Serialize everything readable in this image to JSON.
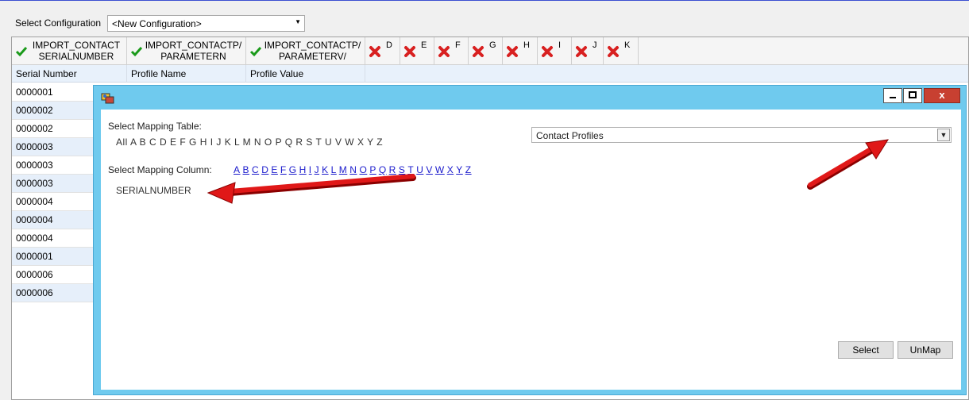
{
  "config": {
    "label": "Select Configuration",
    "value": "<New Configuration>"
  },
  "grid": {
    "headers": [
      {
        "status": "ok",
        "line1": "IMPORT_CONTACT",
        "line2": "SERIALNUMBER"
      },
      {
        "status": "ok",
        "line1": "IMPORT_CONTACTP/",
        "line2": "PARAMETERN"
      },
      {
        "status": "ok",
        "line1": "IMPORT_CONTACTP/",
        "line2": "PARAMETERV/"
      },
      {
        "status": "error",
        "letter": "D"
      },
      {
        "status": "error",
        "letter": "E"
      },
      {
        "status": "error",
        "letter": "F"
      },
      {
        "status": "error",
        "letter": "G"
      },
      {
        "status": "error",
        "letter": "H"
      },
      {
        "status": "error",
        "letter": "I"
      },
      {
        "status": "error",
        "letter": "J"
      },
      {
        "status": "error",
        "letter": "K"
      }
    ],
    "subheaders": [
      "Serial Number",
      "Profile Name",
      "Profile Value"
    ],
    "rows": [
      "0000001",
      "0000002",
      "0000002",
      "0000003",
      "0000003",
      "0000003",
      "0000004",
      "0000004",
      "0000004",
      "0000001",
      "0000006",
      "0000006"
    ]
  },
  "dialog": {
    "mapping_table_label": "Select Mapping Table:",
    "table_letters": "All  A  B  C  D  E  F  G  H  I  J  K  L  M  N  O  P  Q  R  S  T  U  V  W  X  Y  Z",
    "dropdown_value": "Contact Profiles",
    "mapping_column_label": "Select Mapping Column:",
    "column_letters": [
      "A",
      "B",
      "C",
      "D",
      "E",
      "F",
      "G",
      "H",
      "I",
      "J",
      "K",
      "L",
      "M",
      "N",
      "O",
      "P",
      "Q",
      "R",
      "S",
      "T",
      "U",
      "V",
      "W",
      "X",
      "Y",
      "Z"
    ],
    "selected_column": "SERIALNUMBER",
    "select_button": "Select",
    "unmap_button": "UnMap",
    "close_glyph": "x"
  },
  "colors": {
    "ok": "#1a9a1a",
    "error": "#d82020",
    "dialog_frame": "#6fcaee",
    "arrow": "#e01818"
  }
}
